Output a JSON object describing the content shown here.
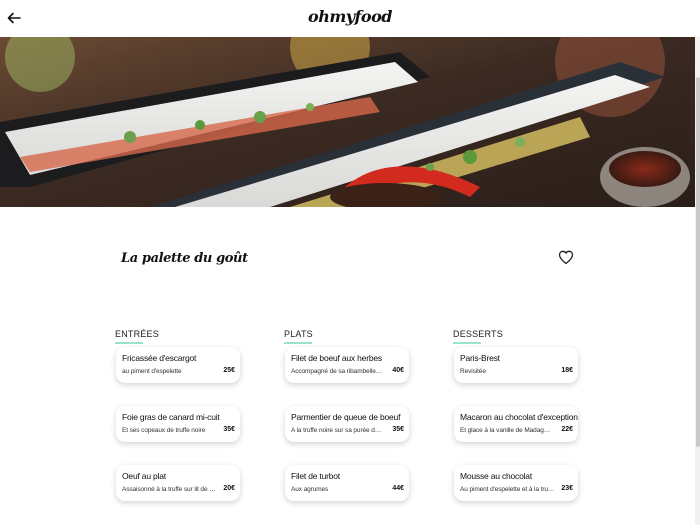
{
  "header": {
    "logo": "ohmyfood"
  },
  "restaurant": {
    "title": "La palette du goût"
  },
  "menu": {
    "columns": [
      {
        "title": "ENTRÉES",
        "items": [
          {
            "name": "Fricassée d'escargot",
            "desc": "au piment d'espelette",
            "price": "25€"
          },
          {
            "name": "Foie gras de canard mi-cuit",
            "desc": "Et ses copeaux de truffe noire",
            "price": "35€"
          },
          {
            "name": "Oeuf au plat",
            "desc": "Assaisonné à la truffe sur lit de caviar",
            "price": "20€"
          }
        ]
      },
      {
        "title": "PLATS",
        "items": [
          {
            "name": "Filet de boeuf aux herbes",
            "desc": "Accompagné de sa ribambelle de légumes",
            "price": "40€"
          },
          {
            "name": "Parmentier de queue de boeuf",
            "desc": "A la truffe noire sur sa purée de panais",
            "price": "35€"
          },
          {
            "name": "Filet de turbot",
            "desc": "Aux agrumes",
            "price": "44€"
          }
        ]
      },
      {
        "title": "DESSERTS",
        "items": [
          {
            "name": "Paris-Brest",
            "desc": "Revisitée",
            "price": "18€"
          },
          {
            "name": "Macaron au chocolat d'exception",
            "desc": "Et glace à la vanille de Madagascar",
            "price": "22€"
          },
          {
            "name": "Mousse au chocolat",
            "desc": "Au piment d'espelette et à la truffe noire",
            "price": "23€"
          }
        ]
      }
    ]
  },
  "colors": {
    "accent": "#99e2d0",
    "text": "#111111"
  },
  "icons": {
    "back": "arrow-left-icon",
    "favorite": "heart-icon"
  }
}
